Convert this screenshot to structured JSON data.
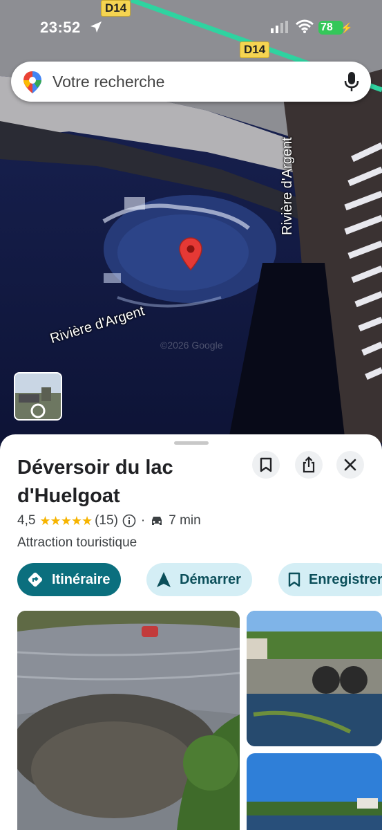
{
  "status_bar": {
    "time": "23:52",
    "battery": "78"
  },
  "map": {
    "road_labels": [
      "D14",
      "D14"
    ],
    "river_label_horizontal": "Rivière d'Argent",
    "river_label_vertical": "Rivière d'Argent",
    "watermark": "©2026 Google"
  },
  "search": {
    "placeholder": "Votre recherche"
  },
  "place": {
    "name": "Déversoir du lac d'Huelgoat",
    "rating": "4,5",
    "stars": "★★★★★",
    "review_count": "(15)",
    "separator": "·",
    "drive_time": "7 min",
    "category": "Attraction touristique"
  },
  "actions": {
    "directions": "Itinéraire",
    "start": "Démarrer",
    "save": "Enregistrer"
  },
  "colors": {
    "primary_chip": "#0b6f7e",
    "secondary_chip": "#d4eef5",
    "marker": "#e53935",
    "stars": "#f6b400"
  }
}
